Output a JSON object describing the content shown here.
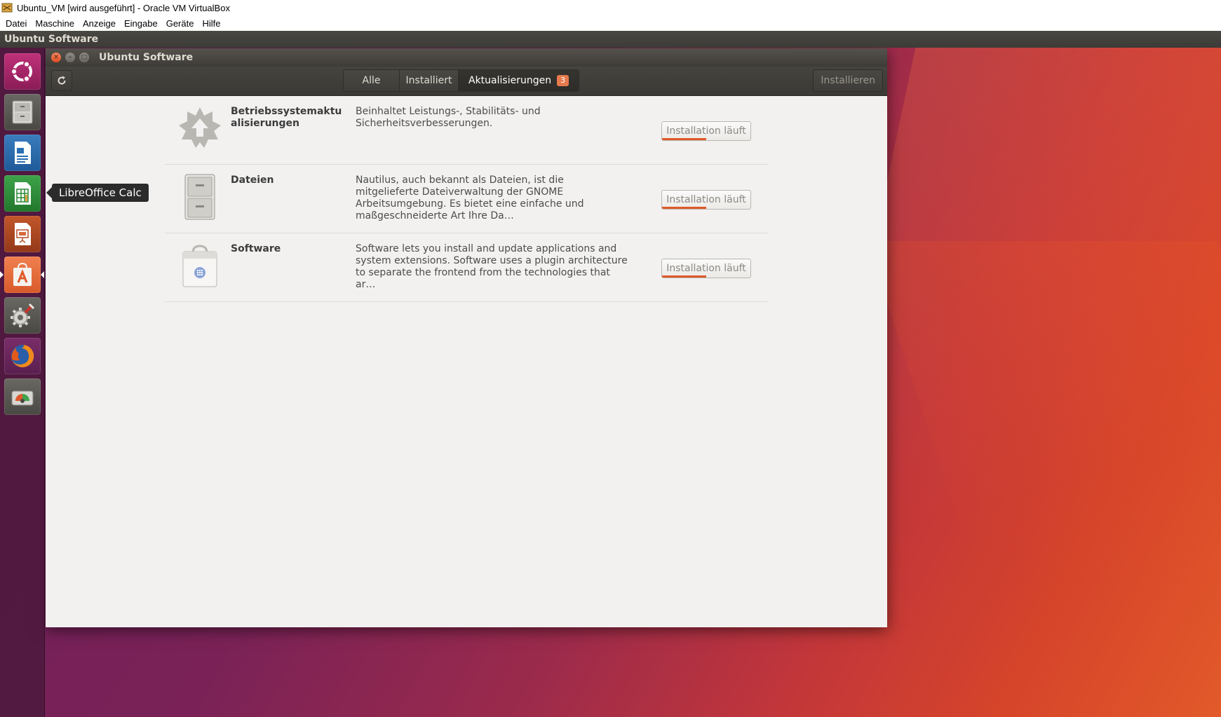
{
  "host": {
    "title": "Ubuntu_VM [wird ausgeführt] - Oracle VM VirtualBox",
    "menu": [
      "Datei",
      "Maschine",
      "Anzeige",
      "Eingabe",
      "Geräte",
      "Hilfe"
    ]
  },
  "vm": {
    "top_panel_title": "Ubuntu Software",
    "launcher": [
      {
        "name": "ubuntu-dash-icon"
      },
      {
        "name": "files-icon"
      },
      {
        "name": "libreoffice-writer-icon"
      },
      {
        "name": "libreoffice-calc-icon"
      },
      {
        "name": "libreoffice-impress-icon"
      },
      {
        "name": "ubuntu-software-icon",
        "active": true
      },
      {
        "name": "system-settings-icon"
      },
      {
        "name": "firefox-icon"
      },
      {
        "name": "disk-usage-icon"
      }
    ],
    "tooltip": "LibreOffice Calc"
  },
  "window": {
    "title": "Ubuntu Software",
    "tabs": [
      {
        "label": "Alle"
      },
      {
        "label": "Installiert"
      },
      {
        "label": "Aktualisierungen",
        "badge": "3",
        "active": true
      }
    ],
    "install_button": "Installieren",
    "updates": [
      {
        "icon": "os-update-icon",
        "name": "Betriebssystemaktualisierungen",
        "description": "Beinhaltet Leistungs-, Stabilitäts- und Sicherheitsverbesserungen.",
        "button": "Installation läuft",
        "progress": 0.5
      },
      {
        "icon": "file-cabinet-icon",
        "name": "Dateien",
        "description": "Nautilus, auch bekannt als Dateien, ist die mitgelieferte Dateiverwaltung der GNOME Arbeitsumgebung. Es bietet eine einfache und maßgeschneiderte Art Ihre Da…",
        "button": "Installation läuft",
        "progress": 0.5
      },
      {
        "icon": "software-bag-icon",
        "name": "Software",
        "description": "Software lets you install and update applications and system extensions.  Software uses a plugin architecture to separate the frontend from the technologies that ar…",
        "button": "Installation läuft",
        "progress": 0.5
      }
    ]
  },
  "colors": {
    "accent": "#e0592a",
    "badge": "#e67a4c",
    "panel": "#3c3b37"
  }
}
